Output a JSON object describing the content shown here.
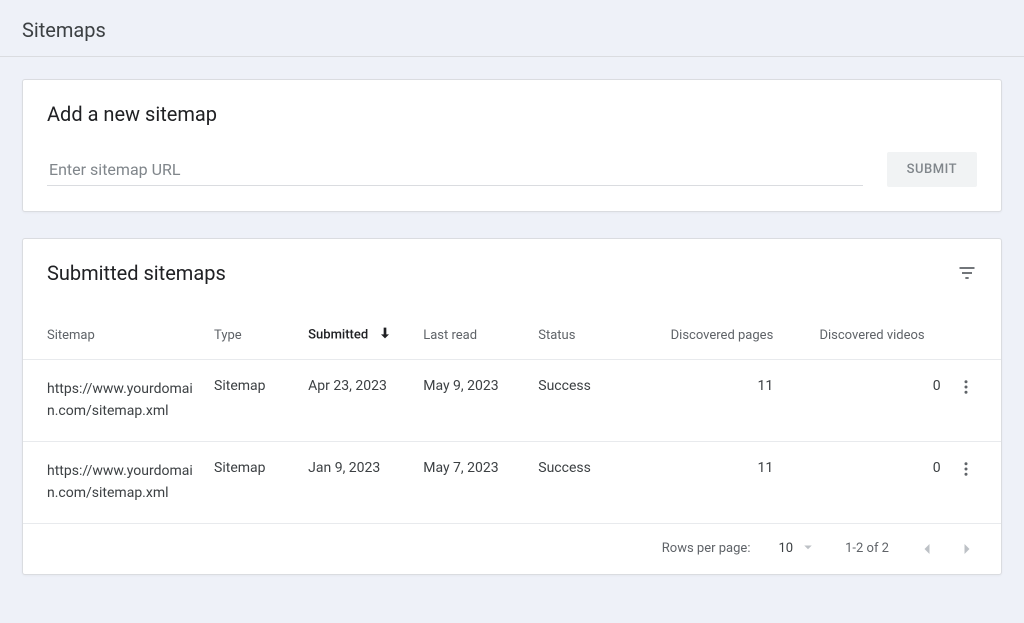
{
  "pageTitle": "Sitemaps",
  "addSitemap": {
    "title": "Add a new sitemap",
    "placeholder": "Enter sitemap URL",
    "submitLabel": "SUBMIT"
  },
  "submitted": {
    "title": "Submitted sitemaps",
    "columns": {
      "sitemap": "Sitemap",
      "type": "Type",
      "submitted": "Submitted",
      "lastRead": "Last read",
      "status": "Status",
      "pages": "Discovered pages",
      "videos": "Discovered videos"
    },
    "rows": [
      {
        "sitemap": "https://www.yourdomain.com/sitemap.xml",
        "type": "Sitemap",
        "submitted": "Apr 23, 2023",
        "lastRead": "May 9, 2023",
        "status": "Success",
        "pages": "11",
        "videos": "0"
      },
      {
        "sitemap": "https://www.yourdomain.com/sitemap.xml",
        "type": "Sitemap",
        "submitted": "Jan 9, 2023",
        "lastRead": "May 7, 2023",
        "status": "Success",
        "pages": "11",
        "videos": "0"
      }
    ]
  },
  "pagination": {
    "rowsLabel": "Rows per page:",
    "rowsValue": "10",
    "range": "1-2 of 2"
  }
}
